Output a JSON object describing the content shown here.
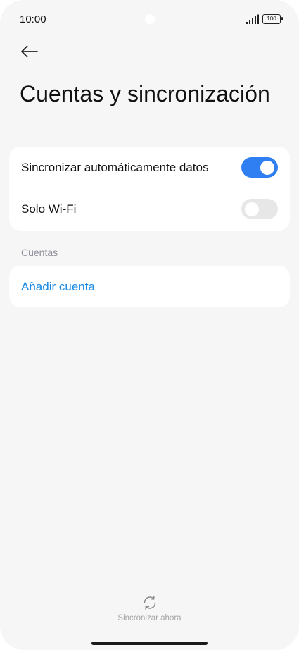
{
  "status_bar": {
    "time": "10:00",
    "battery": "100",
    "icons": [
      "signal-icon",
      "battery-icon"
    ]
  },
  "header": {
    "back_icon": "arrow-left-icon",
    "title": "Cuentas y sincronización"
  },
  "sync_settings": {
    "auto_sync": {
      "label": "Sincronizar automáticamente datos",
      "enabled": true
    },
    "wifi_only": {
      "label": "Solo Wi-Fi",
      "enabled": false
    }
  },
  "accounts": {
    "section_title": "Cuentas",
    "add_account_label": "Añadir cuenta"
  },
  "footer": {
    "sync_icon": "sync-icon",
    "sync_now_label": "Sincronizar ahora"
  },
  "colors": {
    "accent": "#2f7ef2",
    "link": "#1a8ae5",
    "background": "#f6f6f6",
    "card": "#ffffff",
    "section_header": "#8f8f9a"
  }
}
